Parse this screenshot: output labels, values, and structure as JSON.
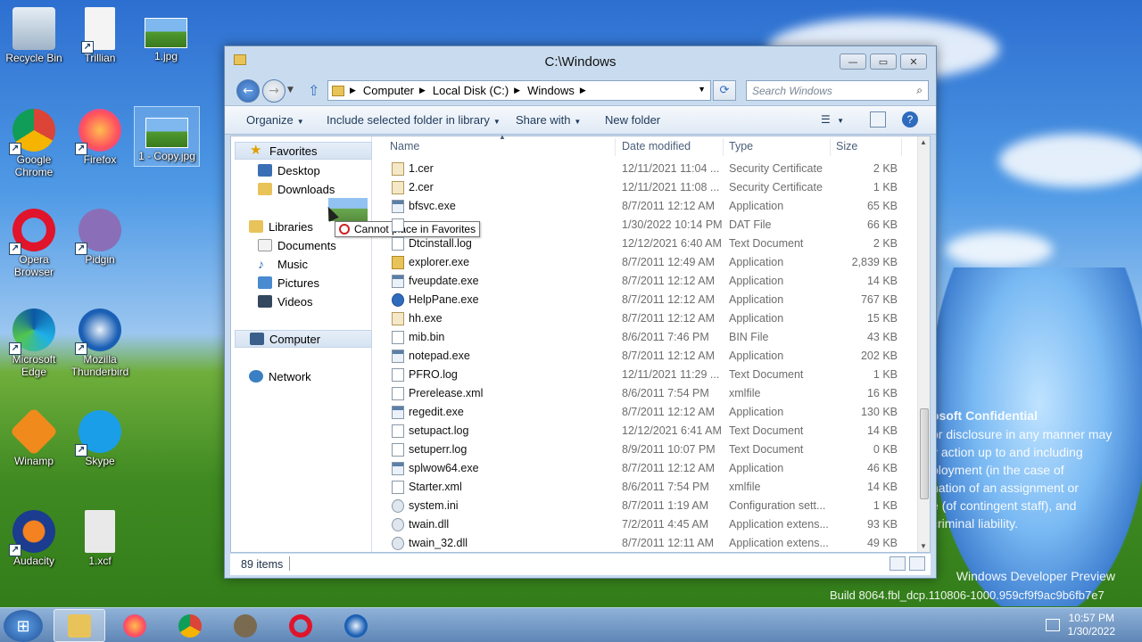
{
  "desktop": {
    "icons": [
      {
        "label": "Recycle Bin"
      },
      {
        "label": "Trillian"
      },
      {
        "label": "1.jpg"
      },
      {
        "label": "Google Chrome"
      },
      {
        "label": "Firefox"
      },
      {
        "label": "1 - Copy.jpg"
      },
      {
        "label": "Opera Browser"
      },
      {
        "label": "Pidgin"
      },
      {
        "label": "Microsoft Edge"
      },
      {
        "label": "Mozilla Thunderbird"
      },
      {
        "label": "Winamp"
      },
      {
        "label": "Skype"
      },
      {
        "label": "Audacity"
      },
      {
        "label": "1.xcf"
      }
    ],
    "watermark": {
      "line1": "osoft Confidential",
      "line2": "or disclosure in any manner may",
      "line3": "y action up to and including",
      "line4": "ployment (in the case of",
      "line5": "nation of an assignment or",
      "line6": "e (of contingent staff), and",
      "line7": "criminal liability.",
      "build1": "Windows Developer Preview",
      "build2": "Build 8064.fbl_dcp.110806-1000.959cf9f9ac9b6fb7e7"
    }
  },
  "window": {
    "title": "C:\\Windows",
    "breadcrumbs": [
      "Computer",
      "Local Disk (C:)",
      "Windows"
    ],
    "search_placeholder": "Search Windows",
    "toolbar": {
      "organize": "Organize",
      "include": "Include selected folder in library",
      "share": "Share with",
      "new_folder": "New folder"
    },
    "nav": {
      "favorites": "Favorites",
      "desktop": "Desktop",
      "downloads": "Downloads",
      "libraries": "Libraries",
      "documents": "Documents",
      "music": "Music",
      "pictures": "Pictures",
      "videos": "Videos",
      "computer": "Computer",
      "network": "Network"
    },
    "drag_tooltip": "Cannot place in Favorites",
    "columns": {
      "name": "Name",
      "date": "Date modified",
      "type": "Type",
      "size": "Size"
    },
    "files": [
      {
        "name": "1.cer",
        "date": "12/11/2021 11:04 ...",
        "type": "Security Certificate",
        "size": "2 KB",
        "icon": "cert"
      },
      {
        "name": "2.cer",
        "date": "12/11/2021 11:08 ...",
        "type": "Security Certificate",
        "size": "1 KB",
        "icon": "cert"
      },
      {
        "name": "bfsvc.exe",
        "date": "8/7/2011 12:12 AM",
        "type": "Application",
        "size": "65 KB",
        "icon": "exe"
      },
      {
        "name": "",
        "date": "1/30/2022 10:14 PM",
        "type": "DAT File",
        "size": "66 KB",
        "icon": "doc"
      },
      {
        "name": "Dtcinstall.log",
        "date": "12/12/2021 6:40 AM",
        "type": "Text Document",
        "size": "2 KB",
        "icon": "doc"
      },
      {
        "name": "explorer.exe",
        "date": "8/7/2011 12:49 AM",
        "type": "Application",
        "size": "2,839 KB",
        "icon": "fold"
      },
      {
        "name": "fveupdate.exe",
        "date": "8/7/2011 12:12 AM",
        "type": "Application",
        "size": "14 KB",
        "icon": "exe"
      },
      {
        "name": "HelpPane.exe",
        "date": "8/7/2011 12:12 AM",
        "type": "Application",
        "size": "767 KB",
        "icon": "help"
      },
      {
        "name": "hh.exe",
        "date": "8/7/2011 12:12 AM",
        "type": "Application",
        "size": "15 KB",
        "icon": "cert"
      },
      {
        "name": "mib.bin",
        "date": "8/6/2011 7:46 PM",
        "type": "BIN File",
        "size": "43 KB",
        "icon": "doc"
      },
      {
        "name": "notepad.exe",
        "date": "8/7/2011 12:12 AM",
        "type": "Application",
        "size": "202 KB",
        "icon": "exe"
      },
      {
        "name": "PFRO.log",
        "date": "12/11/2021 11:29 ...",
        "type": "Text Document",
        "size": "1 KB",
        "icon": "doc"
      },
      {
        "name": "Prerelease.xml",
        "date": "8/6/2011 7:54 PM",
        "type": "xmlfile",
        "size": "16 KB",
        "icon": "doc"
      },
      {
        "name": "regedit.exe",
        "date": "8/7/2011 12:12 AM",
        "type": "Application",
        "size": "130 KB",
        "icon": "exe"
      },
      {
        "name": "setupact.log",
        "date": "12/12/2021 6:41 AM",
        "type": "Text Document",
        "size": "14 KB",
        "icon": "doc"
      },
      {
        "name": "setuperr.log",
        "date": "8/9/2011 10:07 PM",
        "type": "Text Document",
        "size": "0 KB",
        "icon": "doc"
      },
      {
        "name": "splwow64.exe",
        "date": "8/7/2011 12:12 AM",
        "type": "Application",
        "size": "46 KB",
        "icon": "exe"
      },
      {
        "name": "Starter.xml",
        "date": "8/6/2011 7:54 PM",
        "type": "xmlfile",
        "size": "14 KB",
        "icon": "doc"
      },
      {
        "name": "system.ini",
        "date": "8/7/2011 1:19 AM",
        "type": "Configuration sett...",
        "size": "1 KB",
        "icon": "gear"
      },
      {
        "name": "twain.dll",
        "date": "7/2/2011 4:45 AM",
        "type": "Application extens...",
        "size": "93 KB",
        "icon": "gear"
      },
      {
        "name": "twain_32.dll",
        "date": "8/7/2011 12:11 AM",
        "type": "Application extens...",
        "size": "49 KB",
        "icon": "gear"
      }
    ],
    "status": {
      "items": "89 items"
    }
  },
  "taskbar": {
    "time": "10:57 PM",
    "date": "1/30/2022"
  }
}
